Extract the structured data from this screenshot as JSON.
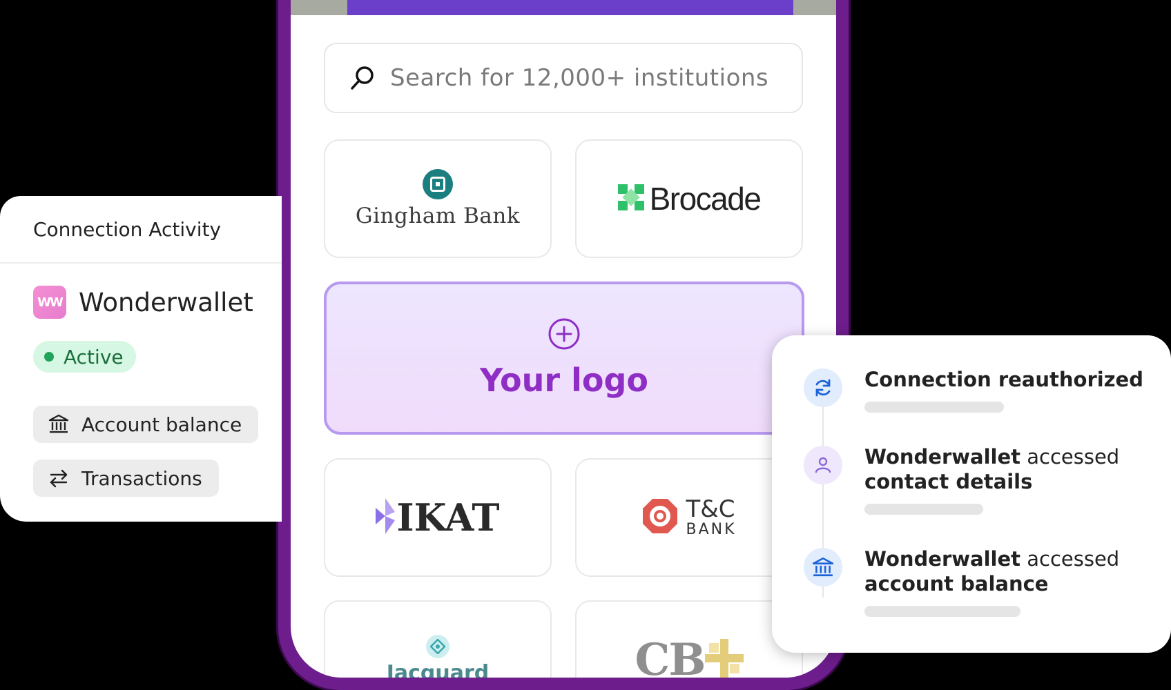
{
  "search": {
    "placeholder": "Search for 12,000+ institutions",
    "icon": "search-icon"
  },
  "institutions": {
    "gingham": {
      "name": "Gingham Bank",
      "icon": "gingham-bank-logo"
    },
    "brocade": {
      "name": "Brocade",
      "icon": "brocade-logo"
    },
    "your_logo": {
      "label": "Your logo",
      "icon": "plus-circle-icon"
    },
    "ikat": {
      "name": "IKAT",
      "icon": "ikat-logo"
    },
    "tc_bank": {
      "line1": "T&C",
      "line2": "BANK",
      "icon": "tc-bank-logo"
    },
    "jacquard": {
      "name": "Jacquard",
      "icon": "jacquard-logo"
    },
    "cb": {
      "name": "CB",
      "icon": "cb-cross-logo"
    }
  },
  "connection_activity": {
    "title": "Connection Activity",
    "app_name": "Wonderwallet",
    "app_logo_text": "WW",
    "status": "Active",
    "permissions": [
      {
        "label": "Account balance",
        "icon": "bank-icon"
      },
      {
        "label": "Transactions",
        "icon": "swap-arrows-icon"
      }
    ]
  },
  "activity_feed": {
    "events": [
      {
        "bold": "Connection reauthorized",
        "rest": "",
        "line2": "",
        "icon": "refresh-icon"
      },
      {
        "bold": "Wonderwallet",
        "rest": " accessed",
        "line2": "contact details",
        "icon": "user-icon"
      },
      {
        "bold": "Wonderwallet",
        "rest": " accessed",
        "line2": "account balance",
        "icon": "bank-icon"
      }
    ]
  },
  "colors": {
    "phone_frame": "#6d1d8c",
    "accent_purple": "#8e2ec4",
    "active_green": "#21a35a",
    "timeline_blue": "#1d63d8"
  }
}
